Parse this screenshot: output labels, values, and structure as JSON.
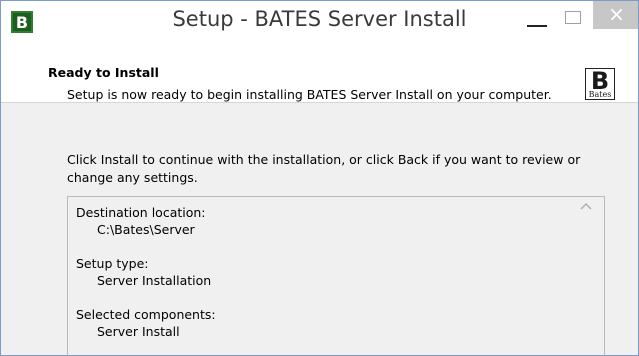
{
  "window": {
    "title": "Setup - BATES Server Install",
    "icon": "bates-app-icon",
    "controls": {
      "minimize": "minimize-icon",
      "maximize": "maximize-icon",
      "close": "×"
    }
  },
  "header": {
    "title": "Ready to Install",
    "subtitle": "Setup is now ready to begin installing BATES Server Install on your computer.",
    "logo": {
      "letter": "B",
      "text": "Bates"
    }
  },
  "body": {
    "instructions": "Click Install to continue with the installation, or click Back if you want to review or change any settings.",
    "memo": [
      {
        "label": "Destination location:",
        "value": "C:\\Bates\\Server"
      },
      {
        "label": "Setup type:",
        "value": "Server Installation"
      },
      {
        "label": "Selected components:",
        "value": "Server Install"
      }
    ]
  },
  "colors": {
    "title_text": "#3a3a3a",
    "close_bg": "#c7c7c7",
    "border": "#7a9cc6"
  }
}
